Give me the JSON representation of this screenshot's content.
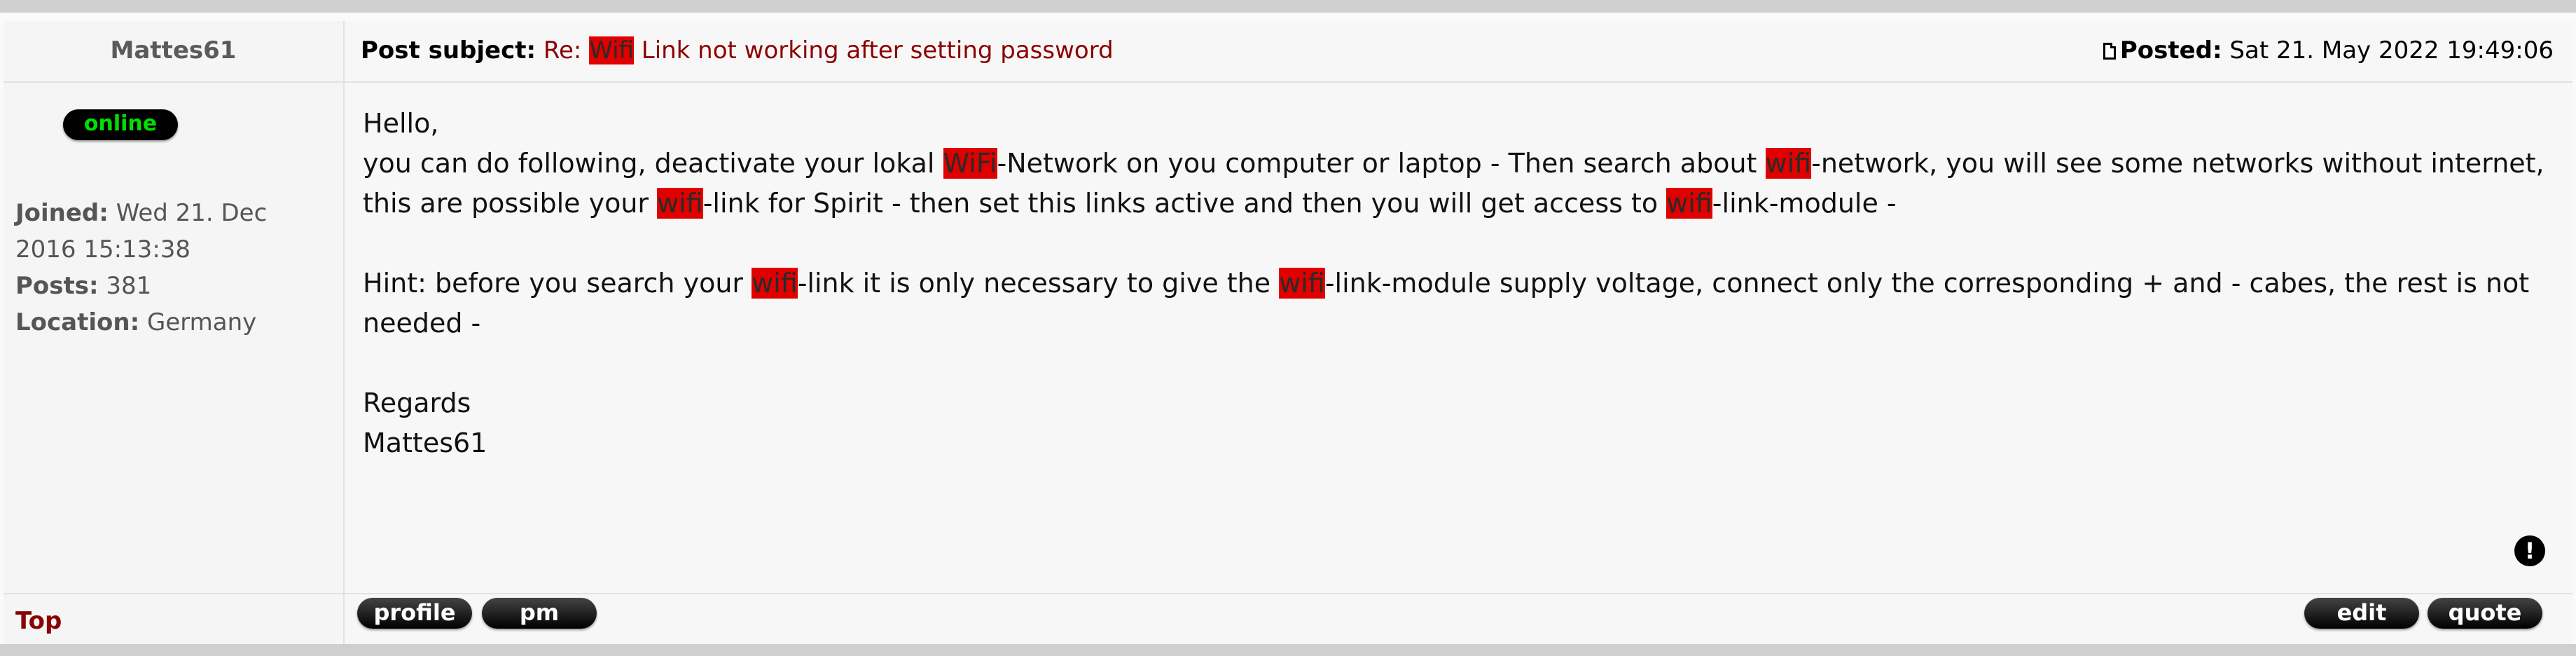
{
  "author": {
    "name": "Mattes61",
    "status_badge": "online",
    "joined_label": "Joined:",
    "joined_value": "Wed 21. Dec 2016 15:13:38",
    "posts_label": "Posts:",
    "posts_value": "381",
    "location_label": "Location:",
    "location_value": "Germany"
  },
  "header": {
    "subject_label": "Post subject:",
    "subject_prefix": "Re: ",
    "subject_highlight": "Wifi",
    "subject_rest": " Link not working after setting password",
    "posted_label": "Posted:",
    "posted_value": "Sat 21. May 2022 19:49:06"
  },
  "body": {
    "l1": "Hello,",
    "l2a": "you can do following, deactivate your lokal ",
    "l2h": "WiFi",
    "l2b": "-Network on you computer or laptop - Then search about ",
    "l2h2": "wifi",
    "l2c": "-network, you will see some networks without internet, this are possible your ",
    "l2h3": "wifi",
    "l2d": "-link for Spirit - then set this links active and then you will get access to ",
    "l2h4": "wifi",
    "l2e": "-link-module -",
    "l3a": "Hint: before you search your ",
    "l3h": "wifi",
    "l3b": "-link it is only necessary to give the ",
    "l3h2": "wifi",
    "l3c": "-link-module supply voltage, connect only the corresponding + and - cabes, the rest is not needed -",
    "l4": "Regards",
    "l5": "Mattes61"
  },
  "footer": {
    "top_link": "Top",
    "profile_button": "profile",
    "pm_button": "pm",
    "edit_button": "edit",
    "quote_button": "quote"
  },
  "colors": {
    "highlight": "#e00000",
    "link": "#8b0000",
    "online": "#00e000"
  },
  "icons": {
    "posted": "document-icon",
    "report": "exclamation-icon"
  }
}
